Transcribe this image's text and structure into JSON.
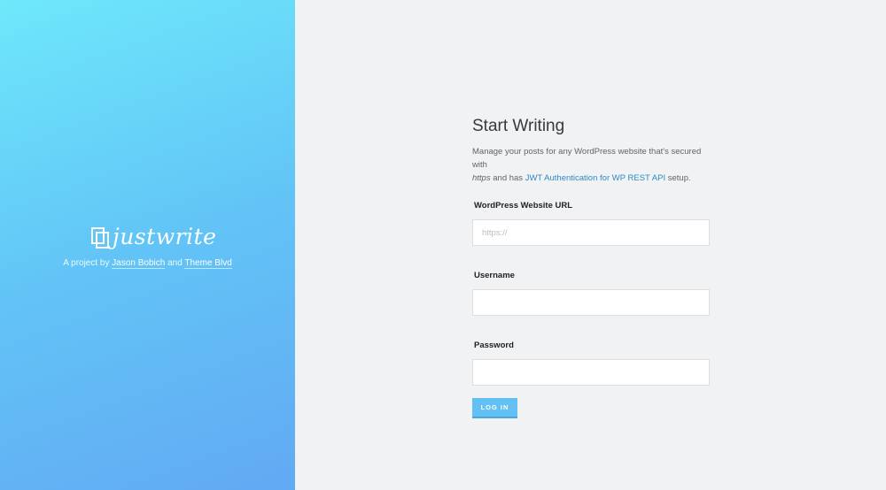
{
  "brand": {
    "logo_text": "justwrite",
    "credit_prefix": "A project by",
    "credit_author": "Jason Bobich",
    "credit_and": "and",
    "credit_company": "Theme Blvd"
  },
  "form": {
    "title": "Start Writing",
    "desc_part1": "Manage your posts for any WordPress website that's secured with",
    "desc_https": "https",
    "desc_part2": "and has",
    "desc_link": "JWT Authentication for WP REST API",
    "desc_part3": "setup.",
    "url_label": "WordPress Website URL",
    "url_placeholder": "https://",
    "url_value": "",
    "username_label": "Username",
    "username_value": "",
    "password_label": "Password",
    "password_value": "",
    "login_label": "LOG IN"
  },
  "colors": {
    "gradient_start": "#6ee8fb",
    "gradient_end": "#62a9f3",
    "accent": "#62c0f2",
    "link": "#2f89c5"
  }
}
